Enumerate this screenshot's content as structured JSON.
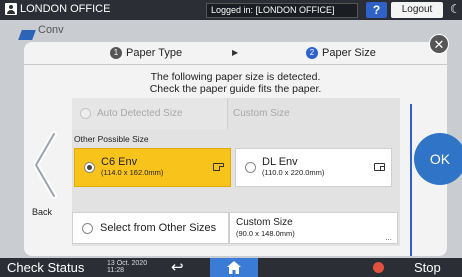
{
  "topbar": {
    "user_name": "LONDON OFFICE",
    "logged_in": "Logged in: [LONDON OFFICE]",
    "help": "?",
    "logout": "Logout"
  },
  "background": {
    "copy_label": "Conv"
  },
  "dialog": {
    "steps": [
      {
        "num": "1",
        "label": "Paper Type"
      },
      {
        "num": "2",
        "label": "Paper Size"
      }
    ],
    "message_line1": "The following paper size is detected.",
    "message_line2": "Check the paper guide fits the paper.",
    "auto_detected": "Auto Detected Size",
    "auto_custom": "Custom Size",
    "other_possible": "Other Possible Size",
    "options": [
      {
        "name": "C6 Env",
        "dim": "(114.0 x 162.0mm)",
        "selected": true
      },
      {
        "name": "DL Env",
        "dim": "(110.0 x 220.0mm)",
        "selected": false
      }
    ],
    "select_other": "Select from Other Sizes",
    "custom_size": {
      "name": "Custom Size",
      "dim": "(90.0 x 148.0mm)",
      "more": "..."
    },
    "back": "Back",
    "ok": "OK"
  },
  "bottombar": {
    "check_status": "Check Status",
    "date": "13 Oct. 2020",
    "time": "11:28",
    "stop": "Stop"
  },
  "colors": {
    "accent": "#2f62c8",
    "selected": "#f8c31a",
    "bar": "#2b2f35"
  }
}
